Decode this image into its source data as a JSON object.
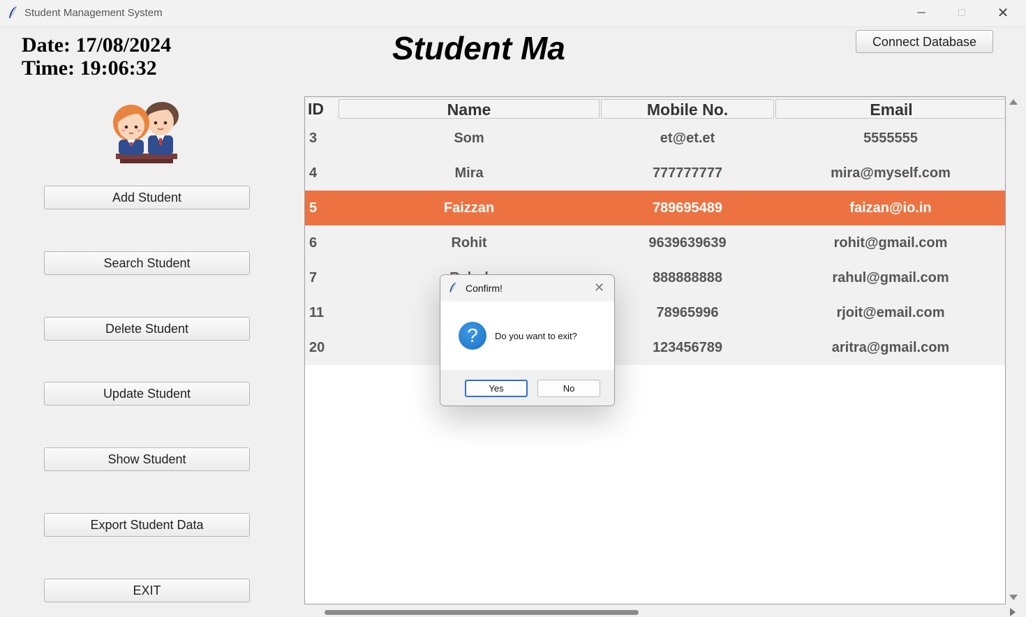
{
  "window": {
    "title": "Student Management System",
    "minimize": "─",
    "maximize": "□",
    "close": "✕"
  },
  "clock": {
    "date": "Date: 17/08/2024",
    "time": "Time: 19:06:32"
  },
  "heading": "Student Ma",
  "connect_button": "Connect Database",
  "sidebar": {
    "buttons": [
      "Add Student",
      "Search Student",
      "Delete Student",
      "Update Student",
      "Show Student",
      "Export Student Data",
      "EXIT"
    ]
  },
  "table": {
    "columns": [
      "ID",
      "Name",
      "Mobile No.",
      "Email"
    ],
    "rows": [
      {
        "id": "3",
        "name": "Som",
        "mobile": "et@et.et",
        "email": "5555555"
      },
      {
        "id": "4",
        "name": "Mira",
        "mobile": "777777777",
        "email": "mira@myself.com"
      },
      {
        "id": "5",
        "name": "Faizzan",
        "mobile": "789695489",
        "email": "faizan@io.in"
      },
      {
        "id": "6",
        "name": "Rohit",
        "mobile": "9639639639",
        "email": "rohit@gmail.com"
      },
      {
        "id": "7",
        "name": "Rahul",
        "mobile": "888888888",
        "email": "rahul@gmail.com"
      },
      {
        "id": "11",
        "name": "",
        "mobile": "78965996",
        "email": "rjoit@email.com"
      },
      {
        "id": "20",
        "name": "",
        "mobile": "123456789",
        "email": "aritra@gmail.com"
      }
    ],
    "selected_row_id": "5",
    "selected_color": "#ec7341"
  },
  "dialog": {
    "title": "Confirm!",
    "close": "✕",
    "icon": "question-icon",
    "icon_glyph": "?",
    "message": "Do you want to exit?",
    "yes_label": "Yes",
    "no_label": "No"
  }
}
